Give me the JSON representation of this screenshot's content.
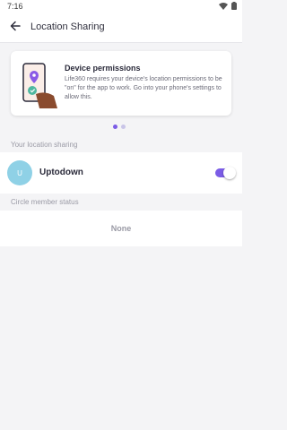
{
  "status_bar": {
    "time": "7:16"
  },
  "app_bar": {
    "title": "Location Sharing"
  },
  "permission_card": {
    "title": "Device permissions",
    "body": "Life360 requires your device's location permissions to be \"on\" for the app to work. Go into your phone's settings to allow this."
  },
  "pager": {
    "count": 2,
    "active_index": 0
  },
  "location_sharing": {
    "header": "Your location sharing",
    "member": {
      "avatar_initial": "U",
      "name": "Uptodown",
      "sharing_on": true
    }
  },
  "circle_status": {
    "header": "Circle member status",
    "value": "None"
  },
  "colors": {
    "accent": "#7b5ce6",
    "avatar": "#8fd1e6",
    "inactive_dot": "#c9c5e8"
  },
  "icons": {
    "back": "arrow-left-icon",
    "wifi": "wifi-icon",
    "battery": "battery-icon",
    "illustration": "phone-location-illustration"
  }
}
